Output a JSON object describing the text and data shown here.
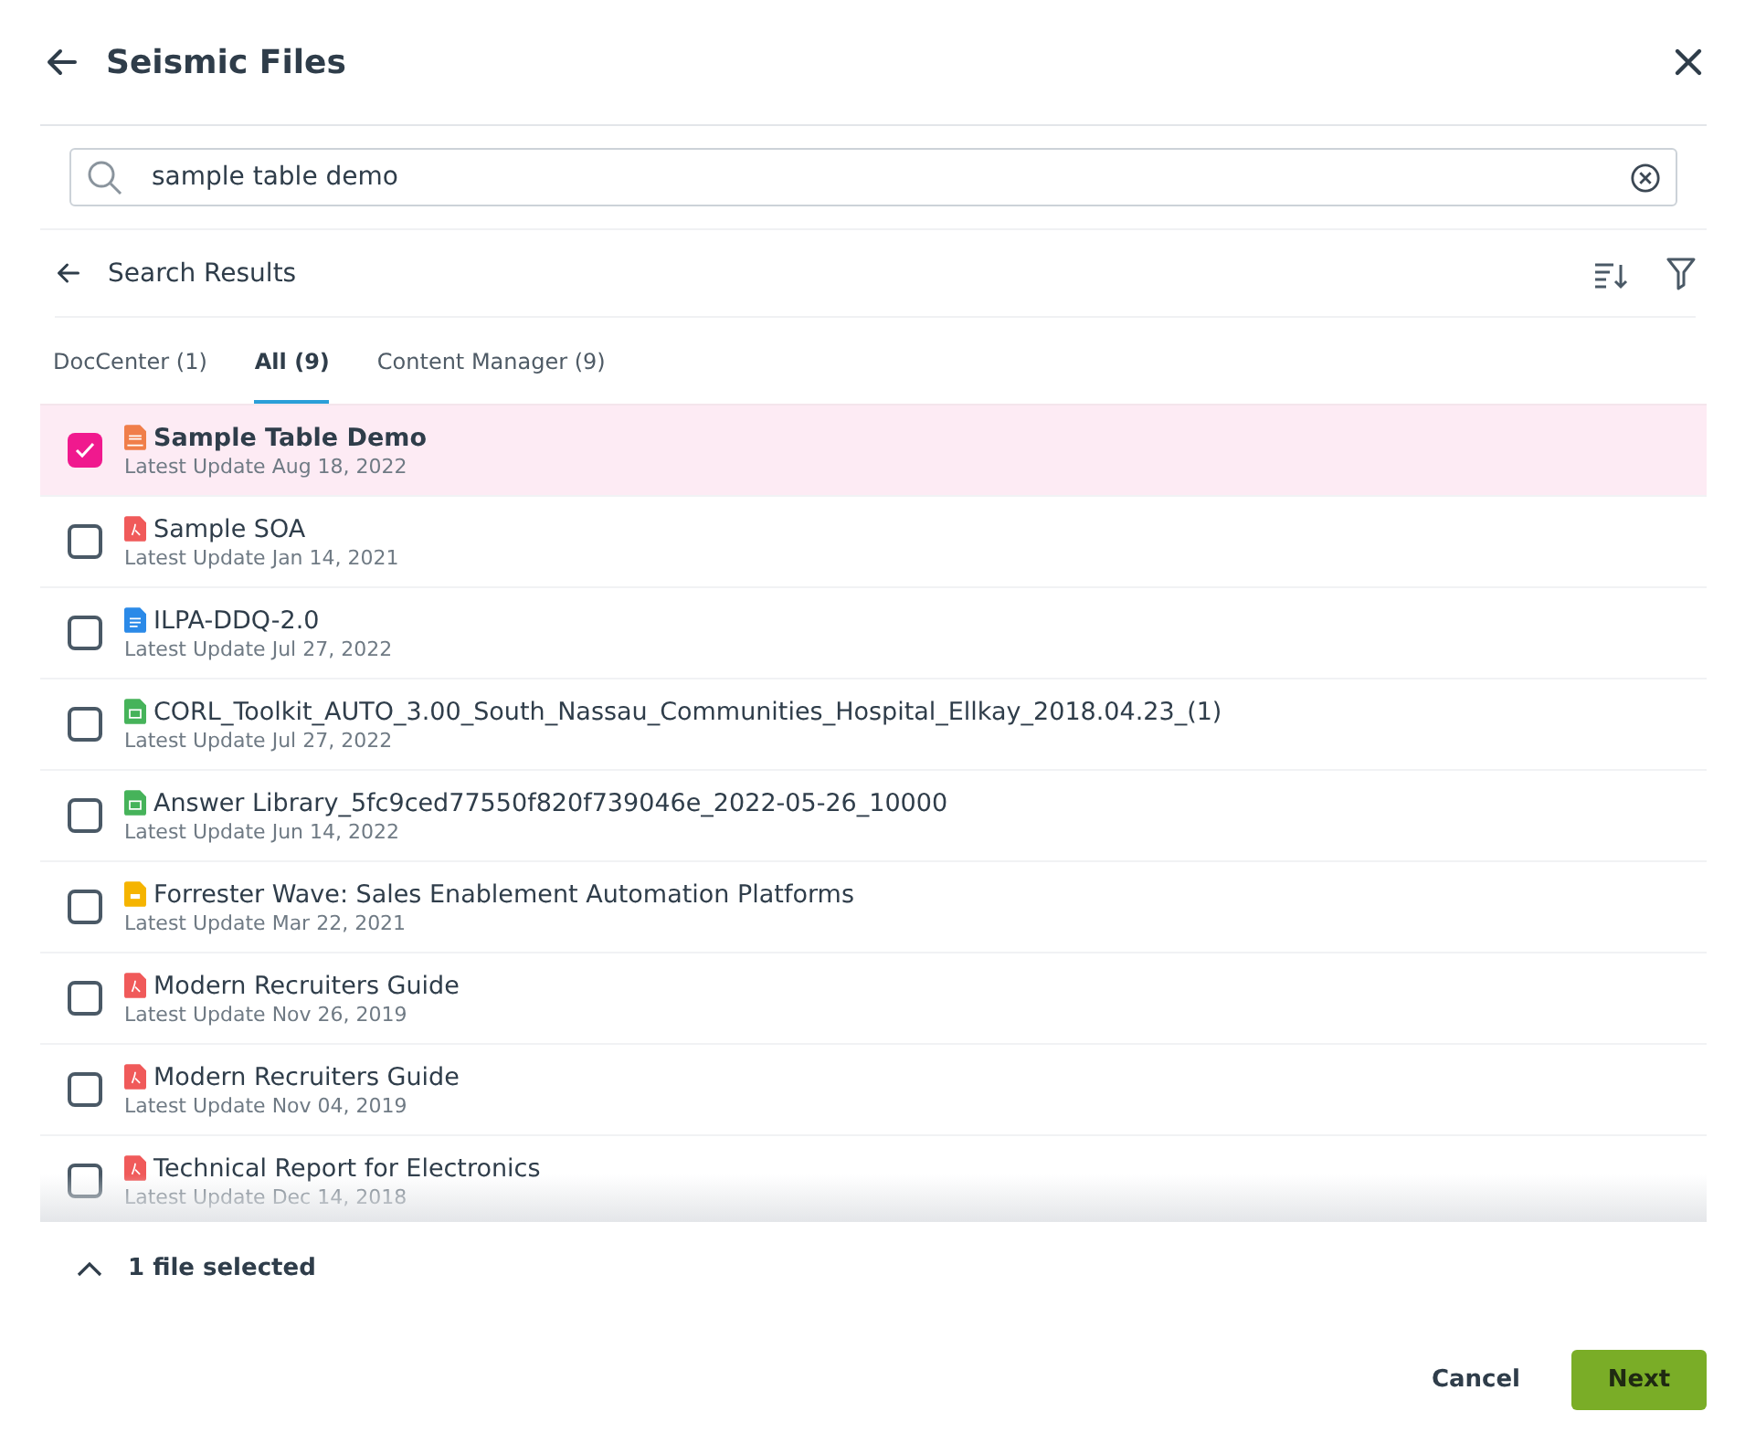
{
  "header": {
    "title": "Seismic Files"
  },
  "search": {
    "value": "sample table demo"
  },
  "results_bar": {
    "title": "Search Results"
  },
  "tabs": [
    {
      "label": "DocCenter (1)",
      "selected": false
    },
    {
      "label": "All (9)",
      "selected": true
    },
    {
      "label": "Content Manager (9)",
      "selected": false
    }
  ],
  "files": [
    {
      "kind": "presentation",
      "name": "Sample Table Demo",
      "updated": "Latest Update Aug 18, 2022",
      "checked": true
    },
    {
      "kind": "pdf",
      "name": "Sample SOA",
      "updated": "Latest Update Jan 14, 2021",
      "checked": false
    },
    {
      "kind": "doc",
      "name": "ILPA-DDQ-2.0",
      "updated": "Latest Update Jul 27, 2022",
      "checked": false
    },
    {
      "kind": "sheet",
      "name": "CORL_Toolkit_AUTO_3.00_South_Nassau_Communities_Hospital_Ellkay_2018.04.23_(1)",
      "updated": "Latest Update Jul 27, 2022",
      "checked": false
    },
    {
      "kind": "sheet",
      "name": "Answer Library_5fc9ced77550f820f739046e_2022-05-26_10000",
      "updated": "Latest Update Jun 14, 2022",
      "checked": false
    },
    {
      "kind": "slides",
      "name": "Forrester Wave: Sales Enablement Automation Platforms",
      "updated": "Latest Update Mar 22, 2021",
      "checked": false
    },
    {
      "kind": "pdf",
      "name": "Modern Recruiters Guide",
      "updated": "Latest Update Nov 26, 2019",
      "checked": false
    },
    {
      "kind": "pdf",
      "name": "Modern Recruiters Guide",
      "updated": "Latest Update Nov 04, 2019",
      "checked": false
    },
    {
      "kind": "pdf",
      "name": "Technical Report for Electronics",
      "updated": "Latest Update Dec 14, 2018",
      "checked": false
    }
  ],
  "selection": {
    "summary": "1 file selected"
  },
  "buttons": {
    "cancel": "Cancel",
    "next": "Next"
  }
}
